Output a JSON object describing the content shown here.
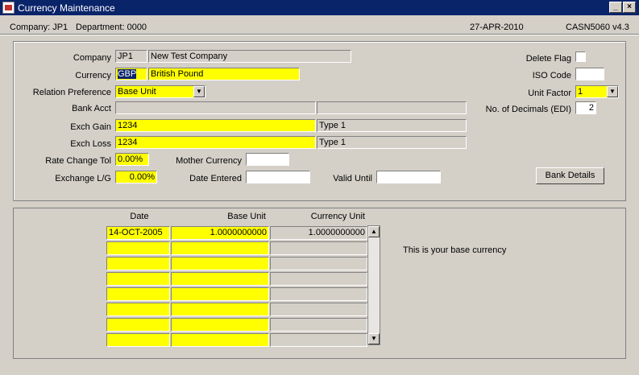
{
  "window": {
    "title": "Currency Maintenance",
    "min_label": "_",
    "close_label": "×"
  },
  "info": {
    "company": "Company:  JP1",
    "department": "Department:  0000",
    "date": "27-APR-2010",
    "program": "CASN5060  v4.3"
  },
  "form": {
    "company_label": "Company",
    "company_code": "JP1",
    "company_name": "New Test Company",
    "currency_label": "Currency",
    "currency_code": "GBP",
    "currency_name": "British Pound",
    "relation_label": "Relation Preference",
    "relation_value": "Base Unit",
    "bank_acct_label": "Bank Acct",
    "bank_acct_value": "",
    "bank_acct_desc": "",
    "exch_gain_label": "Exch Gain",
    "exch_gain_value": "1234",
    "exch_gain_desc": "Type 1",
    "exch_loss_label": "Exch Loss",
    "exch_loss_value": "1234",
    "exch_loss_desc": "Type 1",
    "rate_tol_label": "Rate Change Tol",
    "rate_tol_value": "0.00%",
    "mother_label": "Mother Currency",
    "mother_value": "",
    "exch_lg_label": "Exchange L/G",
    "exch_lg_value": "0.00%",
    "date_entered_label": "Date Entered",
    "date_entered_value": "",
    "valid_until_label": "Valid Until",
    "valid_until_value": "",
    "delete_flag_label": "Delete Flag",
    "iso_label": "ISO Code",
    "iso_value": "",
    "unit_factor_label": "Unit Factor",
    "unit_factor_value": "1",
    "decimals_label": "No. of Decimals (EDI)",
    "decimals_value": "2",
    "bank_details_button": "Bank Details"
  },
  "rates": {
    "headers": {
      "date": "Date",
      "base_unit": "Base Unit",
      "currency_unit": "Currency Unit"
    },
    "rows": [
      {
        "date": "14-OCT-2005",
        "base_unit": "1.0000000000",
        "currency_unit": "1.0000000000"
      },
      {
        "date": "",
        "base_unit": "",
        "currency_unit": ""
      },
      {
        "date": "",
        "base_unit": "",
        "currency_unit": ""
      },
      {
        "date": "",
        "base_unit": "",
        "currency_unit": ""
      },
      {
        "date": "",
        "base_unit": "",
        "currency_unit": ""
      },
      {
        "date": "",
        "base_unit": "",
        "currency_unit": ""
      },
      {
        "date": "",
        "base_unit": "",
        "currency_unit": ""
      },
      {
        "date": "",
        "base_unit": "",
        "currency_unit": ""
      }
    ],
    "message": "This is your base currency"
  },
  "colors": {
    "field_yellow": "#ffff00",
    "titlebar": "#0a246a",
    "window_bg": "#d4d0c8"
  }
}
